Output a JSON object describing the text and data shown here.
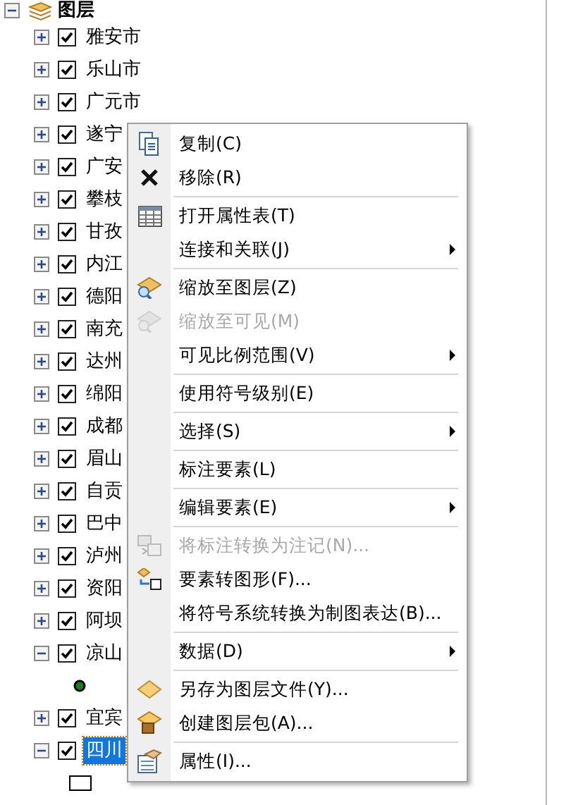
{
  "tree": {
    "label": "图层",
    "expanded": true,
    "children": [
      {
        "label": "雅安市",
        "checked": true,
        "expanded": false
      },
      {
        "label": "乐山市",
        "checked": true,
        "expanded": false
      },
      {
        "label": "广元市",
        "checked": true,
        "expanded": false
      },
      {
        "label": "遂宁",
        "checked": true,
        "expanded": false
      },
      {
        "label": "广安",
        "checked": true,
        "expanded": false
      },
      {
        "label": "攀枝",
        "checked": true,
        "expanded": false
      },
      {
        "label": "甘孜",
        "checked": true,
        "expanded": false
      },
      {
        "label": "内江",
        "checked": true,
        "expanded": false
      },
      {
        "label": "德阳",
        "checked": true,
        "expanded": false
      },
      {
        "label": "南充",
        "checked": true,
        "expanded": false
      },
      {
        "label": "达州",
        "checked": true,
        "expanded": false
      },
      {
        "label": "绵阳",
        "checked": true,
        "expanded": false
      },
      {
        "label": "成都",
        "checked": true,
        "expanded": false
      },
      {
        "label": "眉山",
        "checked": true,
        "expanded": false
      },
      {
        "label": "自贡",
        "checked": true,
        "expanded": false
      },
      {
        "label": "巴中",
        "checked": true,
        "expanded": false
      },
      {
        "label": "泸州",
        "checked": true,
        "expanded": false
      },
      {
        "label": "资阳",
        "checked": true,
        "expanded": false
      },
      {
        "label": "阿坝",
        "checked": true,
        "expanded": false
      },
      {
        "label": "凉山",
        "checked": true,
        "expanded": true,
        "children": [
          {
            "kind": "point",
            "color": "#1f7a1f"
          }
        ]
      },
      {
        "label": "宜宾",
        "checked": true,
        "expanded": false
      },
      {
        "label": "四川",
        "checked": true,
        "expanded": true,
        "selected": true,
        "children": [
          {
            "kind": "polygon",
            "color": "#ffffff"
          }
        ]
      }
    ]
  },
  "context_menu": [
    {
      "kind": "item",
      "label": "复制(C)",
      "disabled": false,
      "submenu": false
    },
    {
      "kind": "item",
      "label": "移除(R)",
      "disabled": false,
      "submenu": false
    },
    {
      "kind": "separator"
    },
    {
      "kind": "item",
      "label": "打开属性表(T)",
      "disabled": false,
      "submenu": false
    },
    {
      "kind": "item",
      "label": "连接和关联(J)",
      "disabled": false,
      "submenu": true
    },
    {
      "kind": "separator"
    },
    {
      "kind": "item",
      "label": "缩放至图层(Z)",
      "disabled": false,
      "submenu": false
    },
    {
      "kind": "item",
      "label": "缩放至可见(M)",
      "disabled": true,
      "submenu": false
    },
    {
      "kind": "item",
      "label": "可见比例范围(V)",
      "disabled": false,
      "submenu": true
    },
    {
      "kind": "separator"
    },
    {
      "kind": "item",
      "label": "使用符号级别(E)",
      "disabled": false,
      "submenu": false
    },
    {
      "kind": "separator"
    },
    {
      "kind": "item",
      "label": "选择(S)",
      "disabled": false,
      "submenu": true
    },
    {
      "kind": "separator"
    },
    {
      "kind": "item",
      "label": "标注要素(L)",
      "disabled": false,
      "submenu": false
    },
    {
      "kind": "separator"
    },
    {
      "kind": "item",
      "label": "编辑要素(E)",
      "disabled": false,
      "submenu": true
    },
    {
      "kind": "separator"
    },
    {
      "kind": "item",
      "label": "将标注转换为注记(N)...",
      "disabled": true,
      "submenu": false
    },
    {
      "kind": "item",
      "label": "要素转图形(F)...",
      "disabled": false,
      "submenu": false
    },
    {
      "kind": "item",
      "label": "将符号系统转换为制图表达(B)...",
      "disabled": false,
      "submenu": false
    },
    {
      "kind": "separator"
    },
    {
      "kind": "item",
      "label": "数据(D)",
      "disabled": false,
      "submenu": true
    },
    {
      "kind": "separator"
    },
    {
      "kind": "item",
      "label": "另存为图层文件(Y)...",
      "disabled": false,
      "submenu": false
    },
    {
      "kind": "item",
      "label": "创建图层包(A)...",
      "disabled": false,
      "submenu": false
    },
    {
      "kind": "separator"
    },
    {
      "kind": "item",
      "label": "属性(I)...",
      "disabled": false,
      "submenu": false
    }
  ]
}
